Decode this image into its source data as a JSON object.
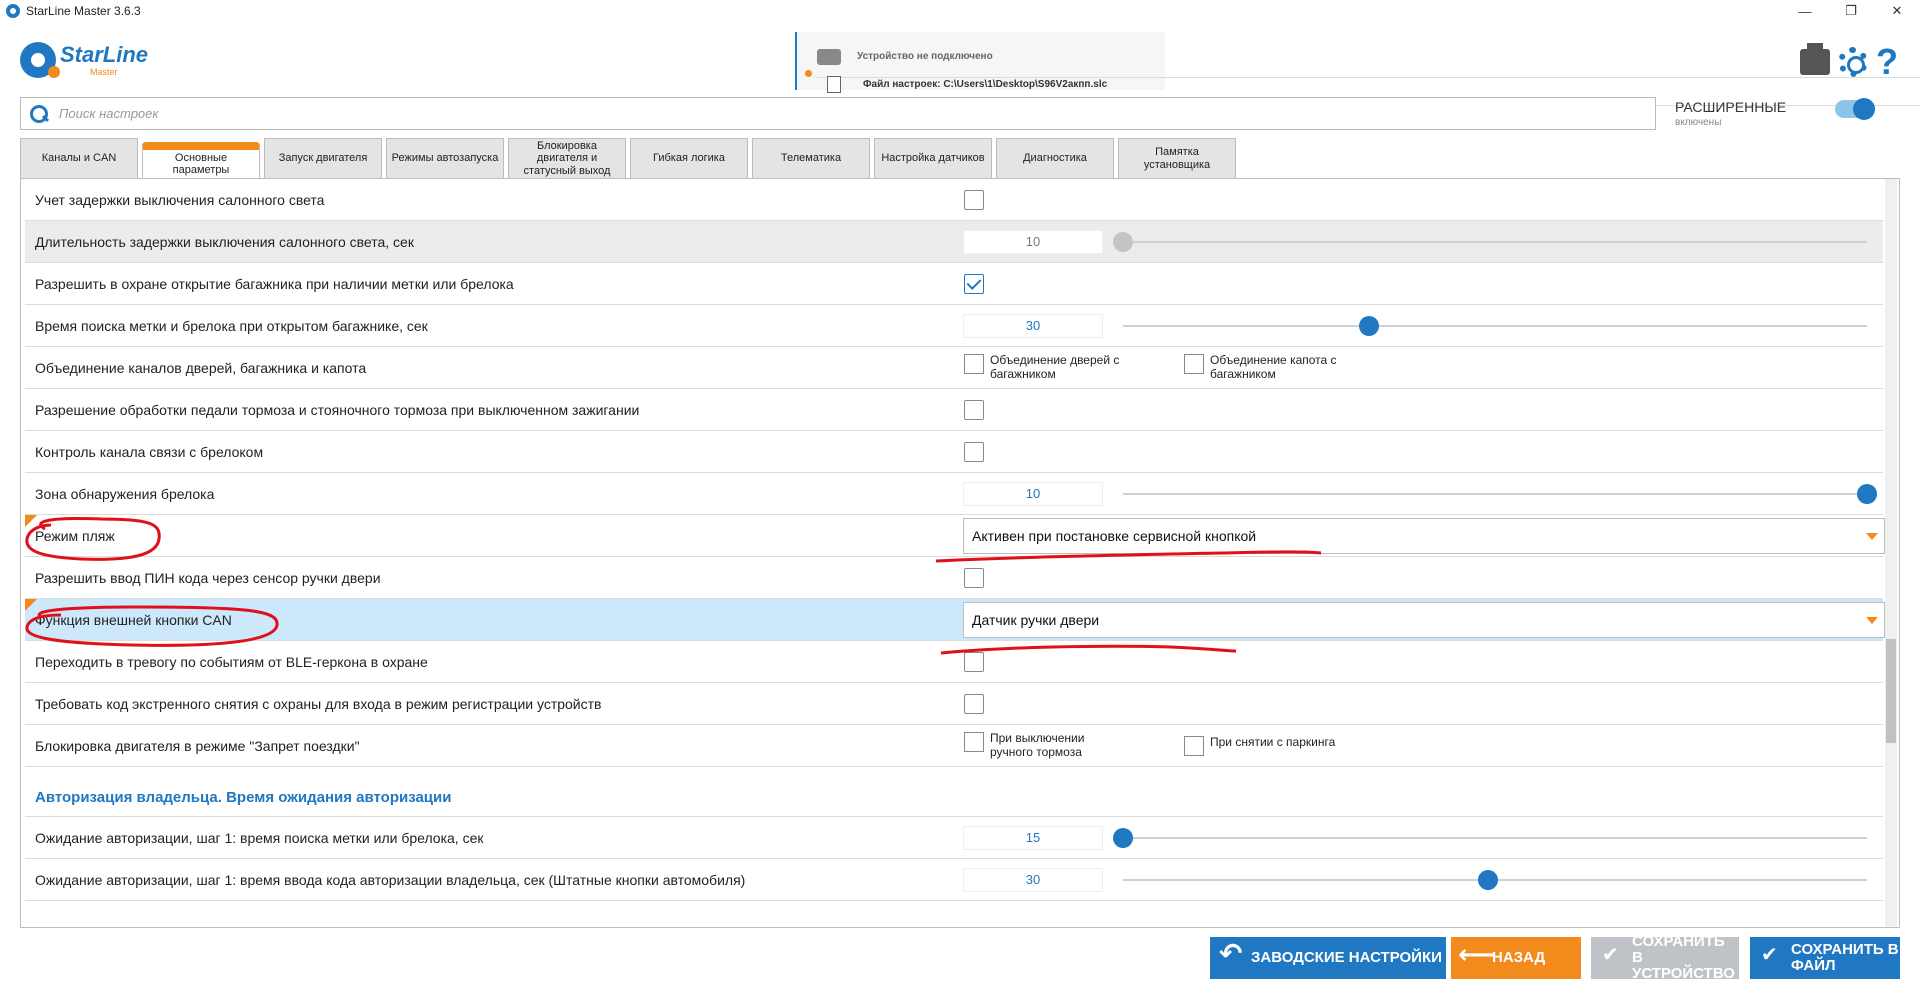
{
  "window": {
    "title": "StarLine Master 3.6.3",
    "minimize": "—",
    "restore": "❐",
    "close": "✕"
  },
  "header": {
    "brand": "StarLine",
    "brand_sub": "Master",
    "device_status": "Устройство не подключено",
    "settings_file": "Файл настроек: C:\\Users\\1\\Desktop\\S96V2акпп.slc"
  },
  "search": {
    "placeholder": "Поиск настроек"
  },
  "advanced": {
    "label": "РАСШИРЕННЫЕ",
    "state": "включены",
    "enabled": true
  },
  "tabs": [
    "Каналы и CAN",
    "Основные параметры",
    "Запуск двигателя",
    "Режимы автозапуска",
    "Блокировка двигателя и статусный выход",
    "Гибкая логика",
    "Телематика",
    "Настройка датчиков",
    "Диагностика",
    "Памятка установщика"
  ],
  "active_tab": "Основные параметры",
  "rows": [
    {
      "label": "Учет задержки выключения салонного света",
      "type": "checkbox",
      "checked": false
    },
    {
      "label": "Длительность задержки выключения салонного света, сек",
      "type": "slider",
      "value": "10",
      "level": 0,
      "disabled": true
    },
    {
      "label": "Разрешить в охране открытие багажника при наличии метки или брелока",
      "type": "checkbox",
      "checked": true
    },
    {
      "label": "Время поиска метки и брелока при открытом багажнике, сек",
      "type": "slider",
      "value": "30",
      "level": 0.33
    },
    {
      "label": "Объединение каналов дверей, багажника и капота",
      "type": "pair",
      "opt1": "Объединение дверей с багажником",
      "opt2": "Объединение капота с багажником"
    },
    {
      "label": "Разрешение обработки педали тормоза и стояночного тормоза при выключенном зажигании",
      "type": "checkbox",
      "checked": false
    },
    {
      "label": "Контроль канала связи с брелоком",
      "type": "checkbox",
      "checked": false
    },
    {
      "label": "Зона обнаружения брелока",
      "type": "slider",
      "value": "10",
      "level": 1
    },
    {
      "label": "Режим пляж",
      "type": "dropdown",
      "value": "Активен при постановке сервисной кнопкой"
    },
    {
      "label": "Разрешить ввод ПИН кода через сенсор ручки двери",
      "type": "checkbox",
      "checked": false
    },
    {
      "label": "Функция внешней кнопки CAN",
      "type": "dropdown",
      "value": "Датчик ручки двери"
    },
    {
      "label": "Переходить в тревогу по событиям от BLE-геркона в охране",
      "type": "checkbox",
      "checked": false
    },
    {
      "label": "Требовать код экстренного снятия с охраны для входа в режим регистрации устройств",
      "type": "checkbox",
      "checked": false
    },
    {
      "label": "Блокировка двигателя в режиме \"Запрет поездки\"",
      "type": "pair",
      "opt1": "При выключении ручного тормоза",
      "opt2": "При снятии с паркинга"
    }
  ],
  "section": {
    "title": "Авторизация владельца. Время ожидания авторизации",
    "rows": [
      {
        "label": "Ожидание авторизации, шаг 1: время поиска метки или брелока, сек",
        "value": "15",
        "level": 0
      },
      {
        "label": "Ожидание авторизации, шаг 1: время ввода кода авторизации владельца, сек (Штатные кнопки автомобиля)",
        "value": "30",
        "level": 0.49
      }
    ]
  },
  "buttons": {
    "factory": "ЗАВОДСКИЕ НАСТРОЙКИ",
    "back": "НАЗАД",
    "save_device": "СОХРАНИТЬ В УСТРОЙСТВО",
    "save_file": "СОХРАНИТЬ В ФАЙЛ"
  },
  "colors": {
    "accent": "#1f78c1",
    "orange": "#f28a1c",
    "annotation": "#e0101a",
    "selected_row": "#cde8fb"
  }
}
